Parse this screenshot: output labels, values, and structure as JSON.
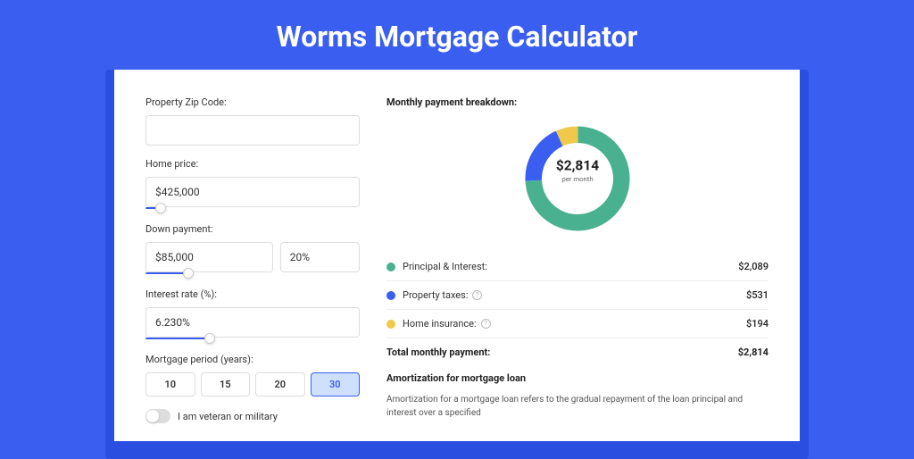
{
  "page": {
    "title": "Worms Mortgage Calculator"
  },
  "inputs": {
    "zip": {
      "label": "Property Zip Code:",
      "value": ""
    },
    "price": {
      "label": "Home price:",
      "value": "$425,000",
      "slider_pct": 7
    },
    "down": {
      "label": "Down payment:",
      "amount": "$85,000",
      "pct": "20%",
      "slider_pct": 20
    },
    "rate": {
      "label": "Interest rate (%):",
      "value": "6.230%",
      "slider_pct": 30
    },
    "period": {
      "label": "Mortgage period (years):",
      "options": [
        "10",
        "15",
        "20",
        "30"
      ],
      "active": "30"
    },
    "veteran": {
      "label": "I am veteran or military"
    }
  },
  "breakdown": {
    "title": "Monthly payment breakdown:",
    "center_amount": "$2,814",
    "center_sub": "per month",
    "rows": [
      {
        "label": "Principal & Interest:",
        "value": "$2,089",
        "color": "#4ab190",
        "info": false
      },
      {
        "label": "Property taxes:",
        "value": "$531",
        "color": "#3a5ef0",
        "info": true
      },
      {
        "label": "Home insurance:",
        "value": "$194",
        "color": "#f0c94a",
        "info": true
      }
    ],
    "total_label": "Total monthly payment:",
    "total_value": "$2,814"
  },
  "amort": {
    "title": "Amortization for mortgage loan",
    "text": "Amortization for a mortgage loan refers to the gradual repayment of the loan principal and interest over a specified"
  },
  "chart_data": {
    "type": "pie",
    "title": "Monthly payment breakdown",
    "series": [
      {
        "name": "Principal & Interest",
        "value": 2089,
        "color": "#4ab190"
      },
      {
        "name": "Property taxes",
        "value": 531,
        "color": "#3a5ef0"
      },
      {
        "name": "Home insurance",
        "value": 194,
        "color": "#f0c94a"
      }
    ],
    "total": 2814
  }
}
